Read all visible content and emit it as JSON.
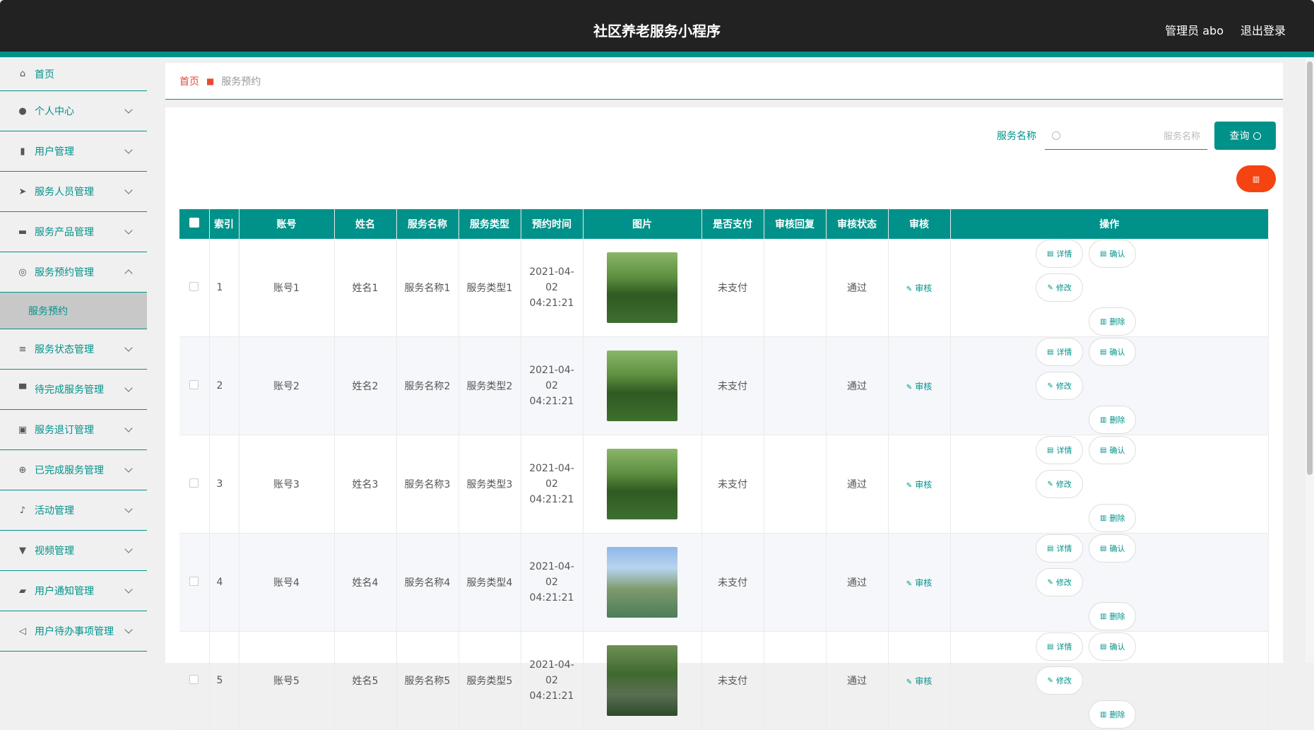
{
  "header": {
    "title": "社区养老服务小程序",
    "user": "管理员 abo",
    "logout": "退出登录"
  },
  "sidebar": {
    "items": [
      {
        "label": "首页",
        "icon": "home-icon"
      },
      {
        "label": "个人中心",
        "icon": "user-icon"
      },
      {
        "label": "用户管理",
        "icon": "bar-chart-icon"
      },
      {
        "label": "服务人员管理",
        "icon": "send-icon"
      },
      {
        "label": "服务产品管理",
        "icon": "chat-icon"
      },
      {
        "label": "服务预约管理",
        "icon": "compass-icon",
        "expanded": true
      },
      {
        "label": "服务状态管理",
        "icon": "list-icon"
      },
      {
        "label": "待完成服务管理",
        "icon": "monitor-icon"
      },
      {
        "label": "服务退订管理",
        "icon": "cancel-box-icon"
      },
      {
        "label": "已完成服务管理",
        "icon": "target-icon"
      },
      {
        "label": "活动管理",
        "icon": "mic-icon"
      },
      {
        "label": "视频管理",
        "icon": "projector-icon"
      },
      {
        "label": "用户通知管理",
        "icon": "ticket-icon"
      },
      {
        "label": "用户待办事项管理",
        "icon": "location-arrow-icon"
      }
    ],
    "sub_active": "服务预约"
  },
  "breadcrumb": {
    "home": "首页",
    "current": "服务预约"
  },
  "search": {
    "label": "服务名称",
    "placeholder": "服务名称",
    "button": "查询"
  },
  "table": {
    "headers": [
      "索引",
      "账号",
      "姓名",
      "服务名称",
      "服务类型",
      "预约时间",
      "图片",
      "是否支付",
      "审核回复",
      "审核状态",
      "审核",
      "操作"
    ],
    "rows": [
      {
        "index": "1",
        "account": "账号1",
        "name": "姓名1",
        "service": "服务名称1",
        "type": "服务类型1",
        "time": "2021-04-02 04:21:21",
        "paid": "未支付",
        "reply": "",
        "status": "通过",
        "audit": "审核"
      },
      {
        "index": "2",
        "account": "账号2",
        "name": "姓名2",
        "service": "服务名称2",
        "type": "服务类型2",
        "time": "2021-04-02 04:21:21",
        "paid": "未支付",
        "reply": "",
        "status": "通过",
        "audit": "审核"
      },
      {
        "index": "3",
        "account": "账号3",
        "name": "姓名3",
        "service": "服务名称3",
        "type": "服务类型3",
        "time": "2021-04-02 04:21:21",
        "paid": "未支付",
        "reply": "",
        "status": "通过",
        "audit": "审核"
      },
      {
        "index": "4",
        "account": "账号4",
        "name": "姓名4",
        "service": "服务名称4",
        "type": "服务类型4",
        "time": "2021-04-02 04:21:21",
        "paid": "未支付",
        "reply": "",
        "status": "通过",
        "audit": "审核"
      },
      {
        "index": "5",
        "account": "账号5",
        "name": "姓名5",
        "service": "服务名称5",
        "type": "服务类型5",
        "time": "2021-04-02 04:21:21",
        "paid": "未支付",
        "reply": "",
        "status": "通过",
        "audit": "审核"
      }
    ],
    "ops": {
      "detail": "详情",
      "confirm": "确认",
      "edit": "修改",
      "delete": "删除"
    }
  },
  "colors": {
    "accent": "#00928a",
    "danger": "#f54311",
    "header": "#222222"
  }
}
